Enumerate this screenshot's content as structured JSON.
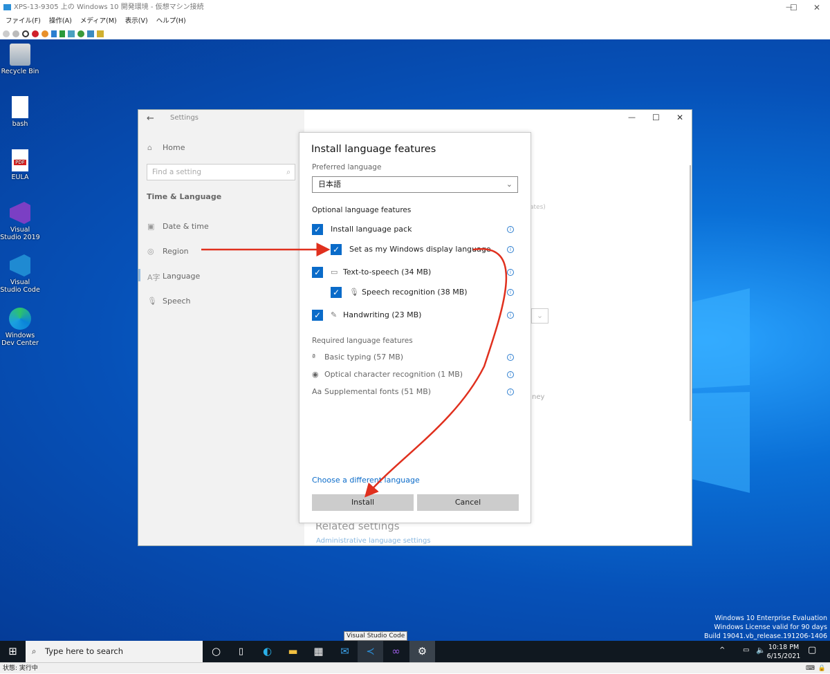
{
  "vm_window": {
    "title": "XPS-13-9305 上の Windows 10 開発環境 - 仮想マシン接続",
    "menu": [
      "ファイル(F)",
      "操作(A)",
      "メディア(M)",
      "表示(V)",
      "ヘルプ(H)"
    ],
    "status": "状態: 実行中"
  },
  "desktop": {
    "icons": [
      {
        "label": "Recycle Bin",
        "icon": "recycle-bin-icon"
      },
      {
        "label": "bash",
        "icon": "file-icon"
      },
      {
        "label": "EULA",
        "icon": "pdf-icon",
        "badge": "PDF"
      },
      {
        "label": "Visual Studio 2019",
        "icon": "visual-studio-icon"
      },
      {
        "label": "Visual Studio Code",
        "icon": "vscode-icon"
      },
      {
        "label": "Windows Dev Center",
        "icon": "edge-icon"
      }
    ],
    "watermark": [
      "Windows 10 Enterprise Evaluation",
      "Windows License valid for 90 days",
      "Build 19041.vb_release.191206-1406"
    ]
  },
  "settings": {
    "title": "Settings",
    "home": "Home",
    "search_placeholder": "Find a setting",
    "section": "Time & Language",
    "nav": [
      "Date & time",
      "Region",
      "Language",
      "Speech"
    ],
    "bg_fragments": {
      "a": "ates)",
      "b": "ney",
      "related": "Related settings",
      "admin": "Administrative language settings"
    }
  },
  "dialog": {
    "title": "Install language features",
    "preferred_label": "Preferred language",
    "preferred_value": "日本語",
    "optional_label": "Optional language features",
    "optional": [
      {
        "label": "Install language pack",
        "checked": true
      },
      {
        "label": "Set as my Windows display language",
        "checked": true
      },
      {
        "label": "Text-to-speech (34 MB)",
        "checked": true
      },
      {
        "label": "Speech recognition (38 MB)",
        "checked": true
      },
      {
        "label": "Handwriting (23 MB)",
        "checked": true
      }
    ],
    "required_label": "Required language features",
    "required": [
      "Basic typing (57 MB)",
      "Optical character recognition (1 MB)",
      "Supplemental fonts (51 MB)"
    ],
    "link": "Choose a different language",
    "install": "Install",
    "cancel": "Cancel"
  },
  "taskbar": {
    "search_placeholder": "Type here to search",
    "tooltip": "Visual Studio Code",
    "time": "10:18 PM",
    "date": "6/15/2021"
  },
  "colors": {
    "accent": "#0a6bc9",
    "arrow": "#e0301e"
  }
}
